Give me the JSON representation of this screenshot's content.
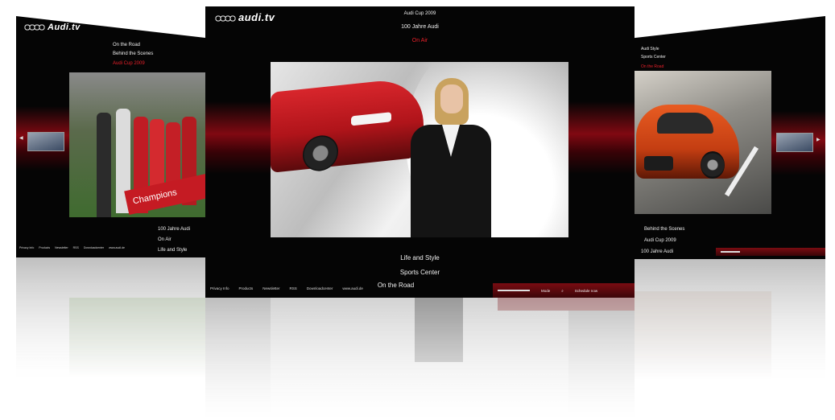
{
  "center": {
    "logo": "audi.tv",
    "menu": [
      "Audi Cup 2009",
      "100 Jahre Audi",
      "On Air"
    ],
    "active_menu": "On Air",
    "sub_menu": [
      "Life and Style",
      "Sports Center",
      "On the Road"
    ],
    "footer_links": [
      "Privacy Info",
      "Products",
      "Newsletter",
      "RSS",
      "Downloadcenter",
      "www.audi.de"
    ],
    "footer_controls": {
      "mode": "Mode",
      "search_icon": "search-icon",
      "action": "Schedule now"
    }
  },
  "left": {
    "logo": "Audi.tv",
    "menu": [
      "On the Road",
      "Behind the Scenes",
      "Audi Cup 2009"
    ],
    "banner": "Champions",
    "sub_menu": [
      "100 Jahre Audi",
      "On Air",
      "Life and Style"
    ],
    "footer_links": [
      "Privacy Info",
      "Products",
      "Newsletter",
      "RSS",
      "Downloadcenter",
      "www.audi.de"
    ]
  },
  "right": {
    "menu": [
      "Audi Style",
      "Sports Center",
      "On the Road"
    ],
    "sub_menu": [
      "Behind the Scenes",
      "Audi Cup 2009",
      "100 Jahre Audi"
    ]
  },
  "colors": {
    "accent": "#e8202a",
    "band": "#96101a",
    "background": "#050505"
  }
}
